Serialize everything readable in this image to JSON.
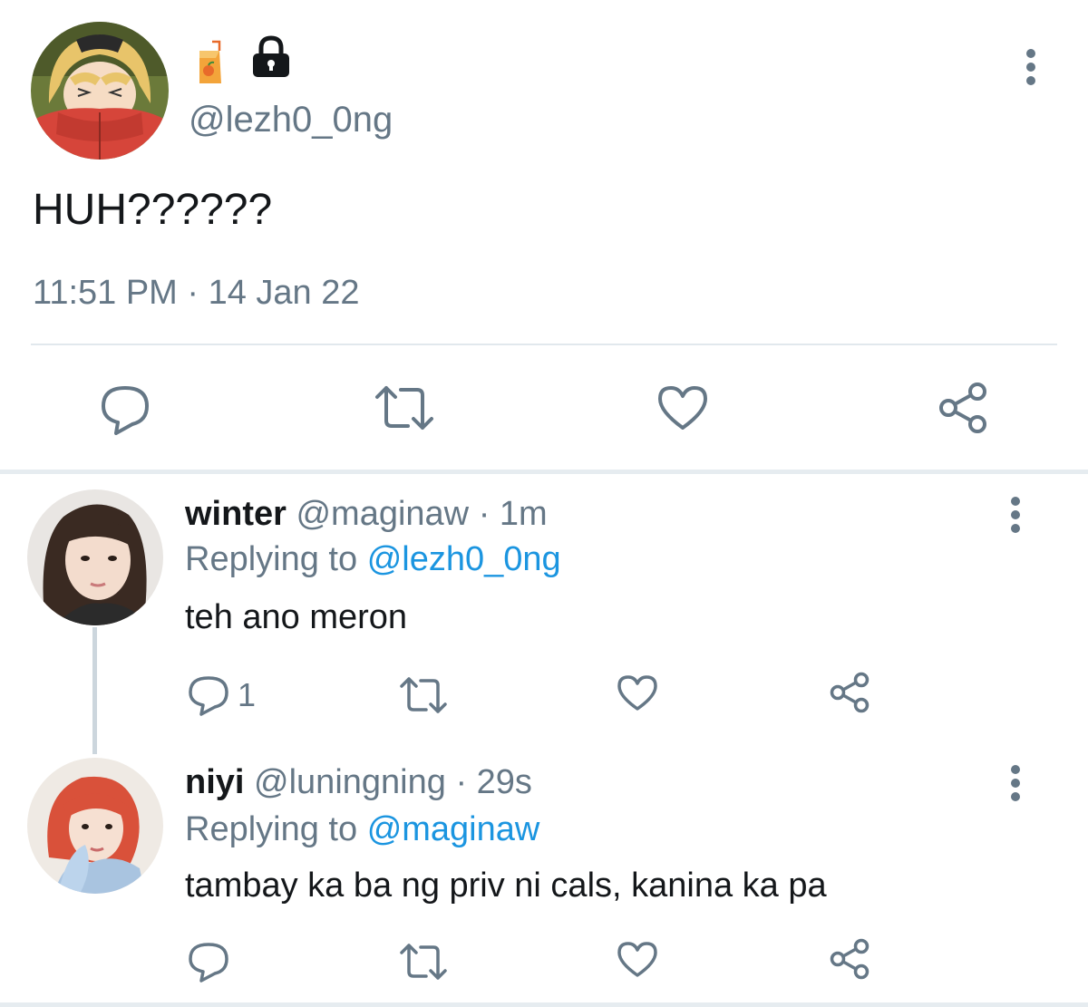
{
  "main_tweet": {
    "handle": "@lezh0_0ng",
    "name_emoji": "juice-box-emoji",
    "protected_icon": "lock-icon",
    "text": "HUH??????",
    "timestamp": "11:51 PM · 14 Jan 22",
    "actions": [
      "reply-icon",
      "retweet-icon",
      "like-icon",
      "share-icon"
    ]
  },
  "replies": [
    {
      "display_name": "winter",
      "handle": "@maginaw",
      "separator": "·",
      "time": "1m",
      "replying_prefix": "Replying to",
      "replying_to": "@lezh0_0ng",
      "text": "teh ano meron",
      "reply_count": "1"
    },
    {
      "display_name": "niyi",
      "handle": "@luningning",
      "separator": "·",
      "time": "29s",
      "replying_prefix": "Replying to",
      "replying_to": "@maginaw",
      "text": "tambay ka ba ng priv ni cals, kanina ka pa",
      "reply_count": ""
    }
  ],
  "colors": {
    "text": "#14171a",
    "secondary": "#657786",
    "link": "#1b95e0",
    "icon": "#657786",
    "divider": "#e1e8ed"
  }
}
